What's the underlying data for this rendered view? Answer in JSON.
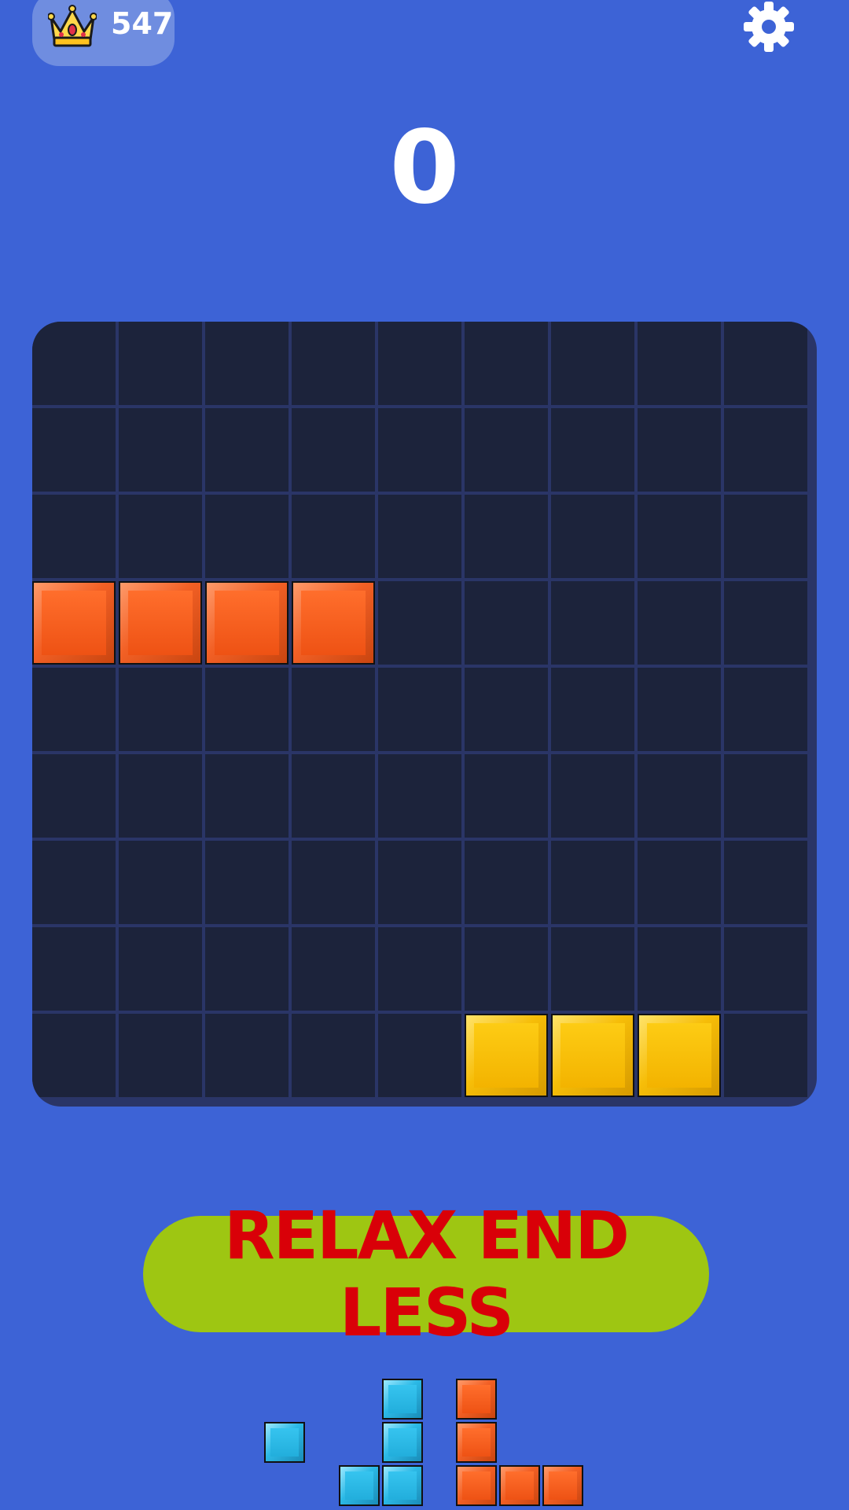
{
  "header": {
    "best_score": "547",
    "score": "0"
  },
  "icons": {
    "best": "crown-icon",
    "settings": "gear-icon"
  },
  "colors": {
    "background": "#3d63d6",
    "board": "#1c233b",
    "orange": "#f26025",
    "yellow": "#f6bd08",
    "cyan": "#2cb9e6",
    "mode_button": "#9ec612",
    "mode_text": "#d90008"
  },
  "board": {
    "rows": 9,
    "cols": 9,
    "filled": [
      {
        "row": 3,
        "col": 0,
        "color": "orange"
      },
      {
        "row": 3,
        "col": 1,
        "color": "orange"
      },
      {
        "row": 3,
        "col": 2,
        "color": "orange"
      },
      {
        "row": 3,
        "col": 3,
        "color": "orange"
      },
      {
        "row": 8,
        "col": 5,
        "color": "yellow"
      },
      {
        "row": 8,
        "col": 6,
        "color": "yellow"
      },
      {
        "row": 8,
        "col": 7,
        "color": "yellow"
      }
    ]
  },
  "mode": {
    "label": "RELAX END LESS"
  },
  "tray": {
    "pieces": [
      {
        "color": "cyan",
        "cells": [
          [
            0,
            0
          ]
        ]
      },
      {
        "color": "cyan",
        "cells": [
          [
            0,
            1
          ],
          [
            1,
            1
          ],
          [
            2,
            0
          ],
          [
            2,
            1
          ]
        ]
      },
      {
        "color": "orange",
        "cells": [
          [
            0,
            0
          ],
          [
            1,
            0
          ],
          [
            2,
            0
          ],
          [
            2,
            1
          ],
          [
            2,
            2
          ]
        ]
      }
    ]
  }
}
